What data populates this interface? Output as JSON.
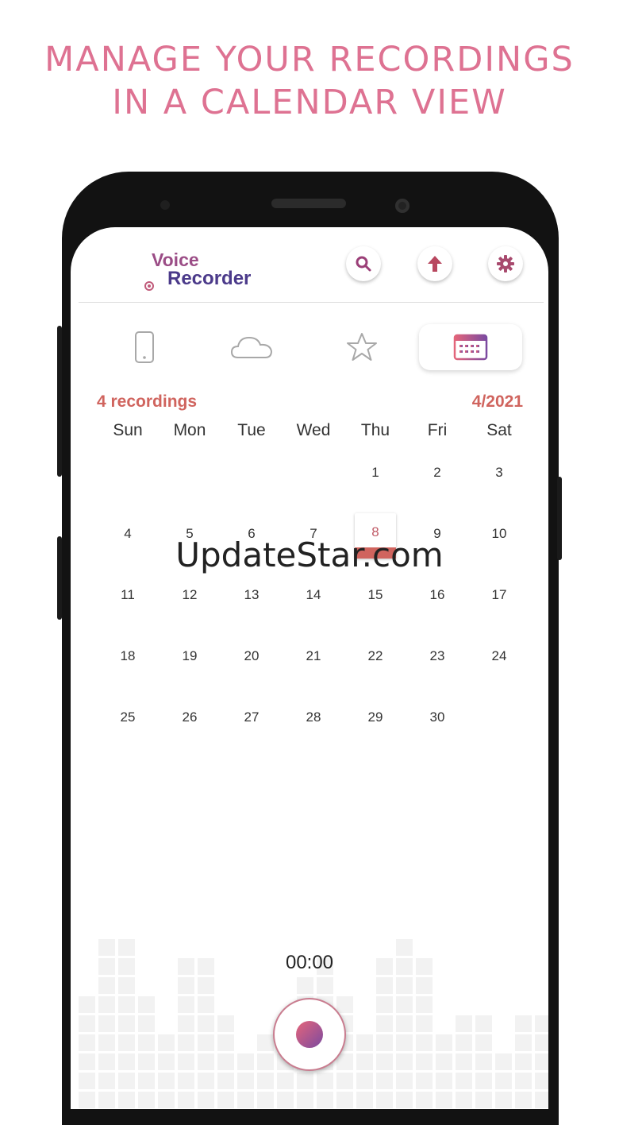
{
  "headline": {
    "line1": "MANAGE YOUR RECORDINGS",
    "line2": "IN A CALENDAR VIEW"
  },
  "app": {
    "logo_word1": "Voice",
    "logo_word2": "Recorder"
  },
  "header_buttons": [
    {
      "name": "search",
      "icon": "search-icon"
    },
    {
      "name": "upload",
      "icon": "upload-arrow-icon"
    },
    {
      "name": "settings",
      "icon": "gear-icon"
    }
  ],
  "tabs": [
    {
      "icon": "phone-icon",
      "active": false
    },
    {
      "icon": "cloud-icon",
      "active": false
    },
    {
      "icon": "star-icon",
      "active": false
    },
    {
      "icon": "calendar-icon",
      "active": true
    }
  ],
  "calendar": {
    "recordings_count": "4 recordings",
    "month": "4/2021",
    "weekdays": [
      "Sun",
      "Mon",
      "Tue",
      "Wed",
      "Thu",
      "Fri",
      "Sat"
    ],
    "days": [
      "",
      "",
      "",
      "",
      "1",
      "2",
      "3",
      "4",
      "5",
      "6",
      "7",
      "8",
      "9",
      "10",
      "11",
      "12",
      "13",
      "14",
      "15",
      "16",
      "17",
      "18",
      "19",
      "20",
      "21",
      "22",
      "23",
      "24",
      "25",
      "26",
      "27",
      "28",
      "29",
      "30",
      ""
    ],
    "day_with_recordings": "8"
  },
  "recorder": {
    "timer": "00:00"
  },
  "watermark": "UpdateStar.com",
  "colors": {
    "accent": "#d0645e",
    "headline": "#de7292",
    "logo_purple": "#4b3a8a"
  }
}
